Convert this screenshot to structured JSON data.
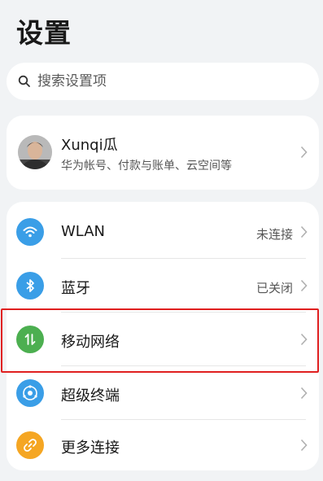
{
  "header": {
    "title": "设置"
  },
  "search": {
    "placeholder": "搜索设置项"
  },
  "profile": {
    "name": "Xunqi瓜",
    "subtitle": "华为帐号、付款与账单、云空间等"
  },
  "items": [
    {
      "label": "WLAN",
      "status": "未连接",
      "icon": "wifi-icon",
      "color": "#3a9ee7"
    },
    {
      "label": "蓝牙",
      "status": "已关闭",
      "icon": "bluetooth-icon",
      "color": "#3a9ee7"
    },
    {
      "label": "移动网络",
      "status": "",
      "icon": "mobile-data-icon",
      "color": "#4caf50"
    },
    {
      "label": "超级终端",
      "status": "",
      "icon": "super-device-icon",
      "color": "#3a9ee7"
    },
    {
      "label": "更多连接",
      "status": "",
      "icon": "link-icon",
      "color": "#f5a623"
    }
  ],
  "colors": {
    "highlight": "#e02020",
    "background": "#f1f3f5"
  }
}
